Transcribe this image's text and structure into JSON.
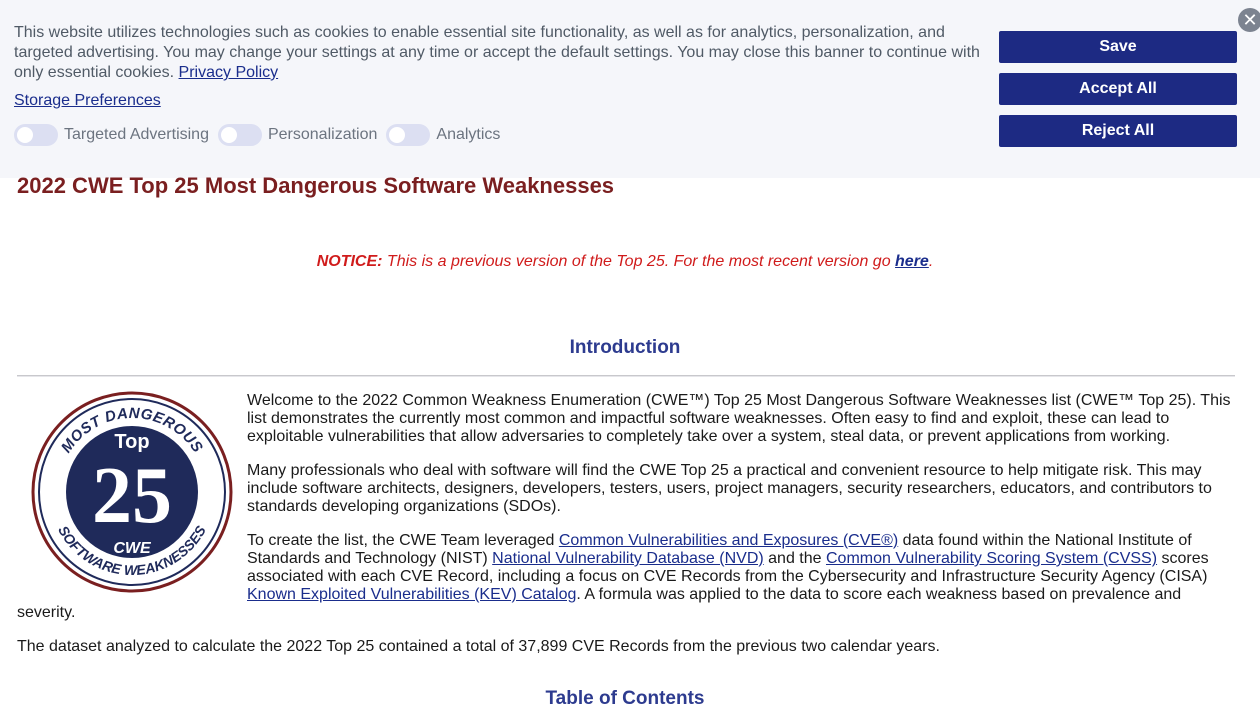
{
  "banner": {
    "text": "This website utilizes technologies such as cookies to enable essential site functionality, as well as for analytics, personalization, and targeted advertising. You may change your settings at any time or accept the default settings. You may close this banner to continue with only essential cookies.",
    "privacy_link": "Privacy Policy",
    "storage_link": "Storage Preferences",
    "toggles": [
      "Targeted Advertising",
      "Personalization",
      "Analytics"
    ],
    "save_label": "Save",
    "accept_label": "Accept All",
    "reject_label": "Reject All",
    "close_glyph": "✕"
  },
  "page": {
    "title": "2022 CWE Top 25 Most Dangerous Software Weaknesses",
    "notice_label": "NOTICE:",
    "notice_text": " This is a previous version of the Top 25. For the most recent version go ",
    "notice_link": "here",
    "notice_end": ".",
    "intro_heading": "Introduction",
    "toc_heading": "Table of Contents"
  },
  "badge": {
    "top_arc": "MOST DANGEROUS",
    "top_word": "Top",
    "number": "25",
    "logo": "CWE",
    "bottom_arc": "SOFTWARE WEAKNESSES"
  },
  "intro": {
    "p1": "Welcome to the 2022 Common Weakness Enumeration (CWE™) Top 25 Most Dangerous Software Weaknesses list (CWE™ Top 25). This list demonstrates the currently most common and impactful software weaknesses. Often easy to find and exploit, these can lead to exploitable vulnerabilities that allow adversaries to completely take over a system, steal data, or prevent applications from working.",
    "p2": "Many professionals who deal with software will find the CWE Top 25 a practical and convenient resource to help mitigate risk. This may include software architects, designers, developers, testers, users, project managers, security researchers, educators, and contributors to standards developing organizations (SDOs).",
    "p3_a": "To create the list, the CWE Team leveraged ",
    "p3_link1": "Common Vulnerabilities and Exposures (CVE®)",
    "p3_b": " data found within the National Institute of Standards and Technology (NIST) ",
    "p3_link2": "National Vulnerability Database (NVD)",
    "p3_c": " and the ",
    "p3_link3": "Common Vulnerability Scoring System (CVSS)",
    "p3_d": " scores associated with each CVE Record, including a focus on CVE Records from the Cybersecurity and Infrastructure Security Agency (CISA) ",
    "p3_link4": "Known Exploited Vulnerabilities (KEV) Catalog",
    "p3_e": ". A formula was applied to the data to score each weakness based on prevalence and",
    "p3_wrap": "severity.",
    "p4": "The dataset analyzed to calculate the 2022 Top 25 contained a total of 37,899 CVE Records from the previous two calendar years."
  },
  "colors": {
    "title": "#7a1f20",
    "notice": "#d01b1b",
    "heading": "#2d3b8f",
    "button": "#1d2a83",
    "link": "#1a2d8c",
    "banner_bg": "#f5f6fa"
  }
}
